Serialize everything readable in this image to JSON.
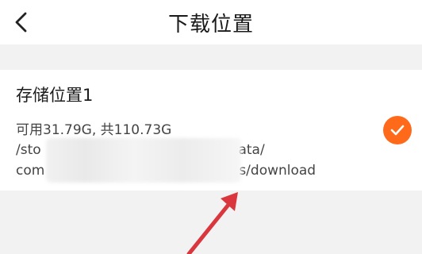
{
  "header": {
    "title": "下载位置"
  },
  "location": {
    "name": "存储位置1",
    "space": "可用31.79G, 共110.73G",
    "path_line1_start": "/sto",
    "path_line1_end": "data/",
    "path_line2_start": "com",
    "path_line2_end": "s/download"
  },
  "colors": {
    "accent": "#ff6a1a",
    "arrow": "#d9363e"
  },
  "icons": {
    "back": "chevron-left-icon",
    "selected": "check-icon"
  }
}
